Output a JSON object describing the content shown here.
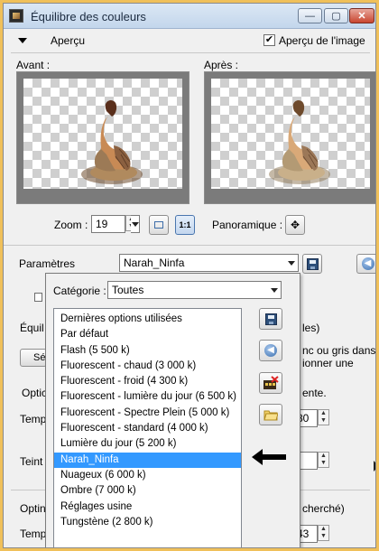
{
  "window": {
    "title": "Équilibre des couleurs"
  },
  "window_buttons": {
    "minimize": "—",
    "maximize": "▢",
    "close": "✕"
  },
  "preview": {
    "toggle_label": "Aperçu",
    "checkbox_label": "Aperçu de l'image",
    "checkbox_checked": true,
    "before_label": "Avant :",
    "after_label": "Après :"
  },
  "zoom": {
    "label": "Zoom :",
    "value": "19",
    "pan_label": "Panoramique :"
  },
  "parameters": {
    "label": "Paramètres",
    "preset_value": "Narah_Ninfa"
  },
  "popup": {
    "category_label": "Catégorie :",
    "category_value": "Toutes",
    "items": [
      "Dernières options utilisées",
      "Par défaut",
      "Flash (5 500 k)",
      "Fluorescent - chaud (3 000 k)",
      "Fluorescent - froid (4 300 k)",
      "Fluorescent - lumière du jour (6 500 k)",
      "Fluorescent - Spectre Plein (5 000 k)",
      "Fluorescent - standard (4 000 k)",
      "Lumière du jour (5 200 k)",
      "Narah_Ninfa",
      "Nuageux (6 000 k)",
      "Ombre (7 000 k)",
      "Réglages usine",
      "Tungstène (2 800 k)"
    ],
    "selected_index": 9
  },
  "background_fragments": {
    "equil": "Équil",
    "les_paren": "les)",
    "se_btn": "Sé",
    "nc_gris": "nc ou gris dans la",
    "ionner": "ionner une",
    "opti1": "Optic",
    "ente": "ente.",
    "temp1": "Temp",
    "val80": "80",
    "teint": "Teint",
    "opti2": "Optin",
    "cherche": "cherché)",
    "temp2": "Temp",
    "val43": "43"
  },
  "colors": {
    "selection": "#3399ff",
    "frame": "#f0c05a",
    "title_bg": "#c3d6ec"
  },
  "icons": [
    "app-icon",
    "save-icon",
    "back-arrow-icon",
    "zoom-fit-icon",
    "zoom-1to1-icon",
    "pan-icon",
    "delete-preset-icon",
    "folder-icon",
    "pointer-arrow-icon"
  ]
}
